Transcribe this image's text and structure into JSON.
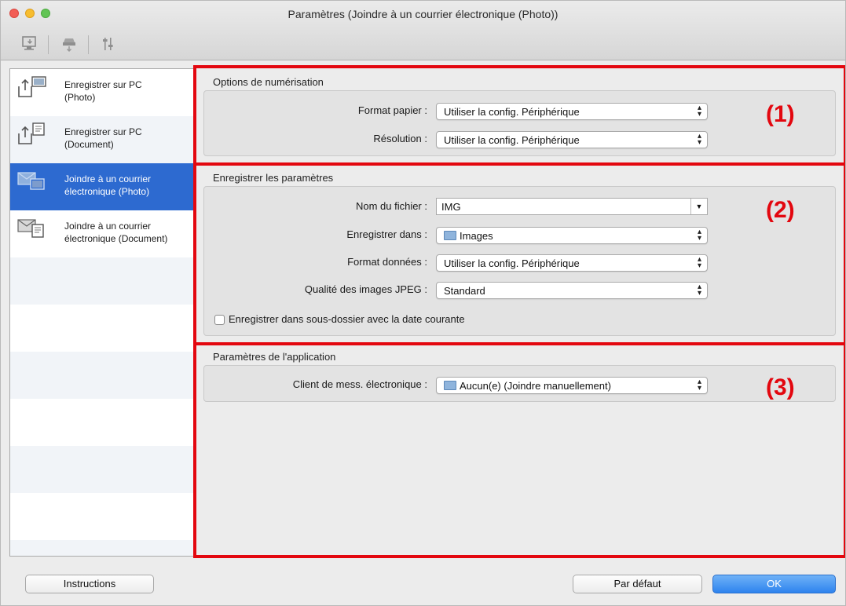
{
  "window": {
    "title": "Paramètres (Joindre à un courrier électronique (Photo))"
  },
  "toolbar": {
    "tabs": [
      {
        "icon": "scan-from-computer-icon"
      },
      {
        "icon": "scan-from-panel-icon"
      },
      {
        "icon": "general-settings-icon"
      }
    ]
  },
  "sidebar": {
    "items": [
      {
        "label": "Enregistrer sur PC\n(Photo)",
        "icon": "save-photo-icon"
      },
      {
        "label": "Enregistrer sur PC\n(Document)",
        "icon": "save-document-icon"
      },
      {
        "label": "Joindre à un courrier\nélectronique (Photo)",
        "icon": "email-photo-icon",
        "selected": true
      },
      {
        "label": "Joindre à un courrier\nélectronique (Document)",
        "icon": "email-document-icon"
      }
    ]
  },
  "scan_options": {
    "title": "Options de numérisation",
    "paper_size_label": "Format papier :",
    "paper_size_value": "Utiliser la config. Périphérique",
    "resolution_label": "Résolution :",
    "resolution_value": "Utiliser la config. Périphérique",
    "marker": "(1)"
  },
  "save_settings": {
    "title": "Enregistrer les paramètres",
    "file_name_label": "Nom du fichier :",
    "file_name_value": "IMG",
    "save_in_label": "Enregistrer dans :",
    "save_in_value": "Images",
    "data_format_label": "Format données :",
    "data_format_value": "Utiliser la config. Périphérique",
    "jpeg_quality_label": "Qualité des images JPEG :",
    "jpeg_quality_value": "Standard",
    "subfolder_checkbox_label": "Enregistrer dans sous-dossier avec la date courante",
    "subfolder_checked": false,
    "marker": "(2)"
  },
  "app_settings": {
    "title": "Paramètres de l'application",
    "mail_client_label": "Client de mess. électronique :",
    "mail_client_value": "Aucun(e) (Joindre manuellement)",
    "marker": "(3)"
  },
  "buttons": {
    "instructions": "Instructions",
    "defaults": "Par défaut",
    "ok": "OK"
  },
  "colors": {
    "highlight": "#e3070f",
    "selection": "#2d6ad0",
    "default_button": "#2d83ee"
  }
}
